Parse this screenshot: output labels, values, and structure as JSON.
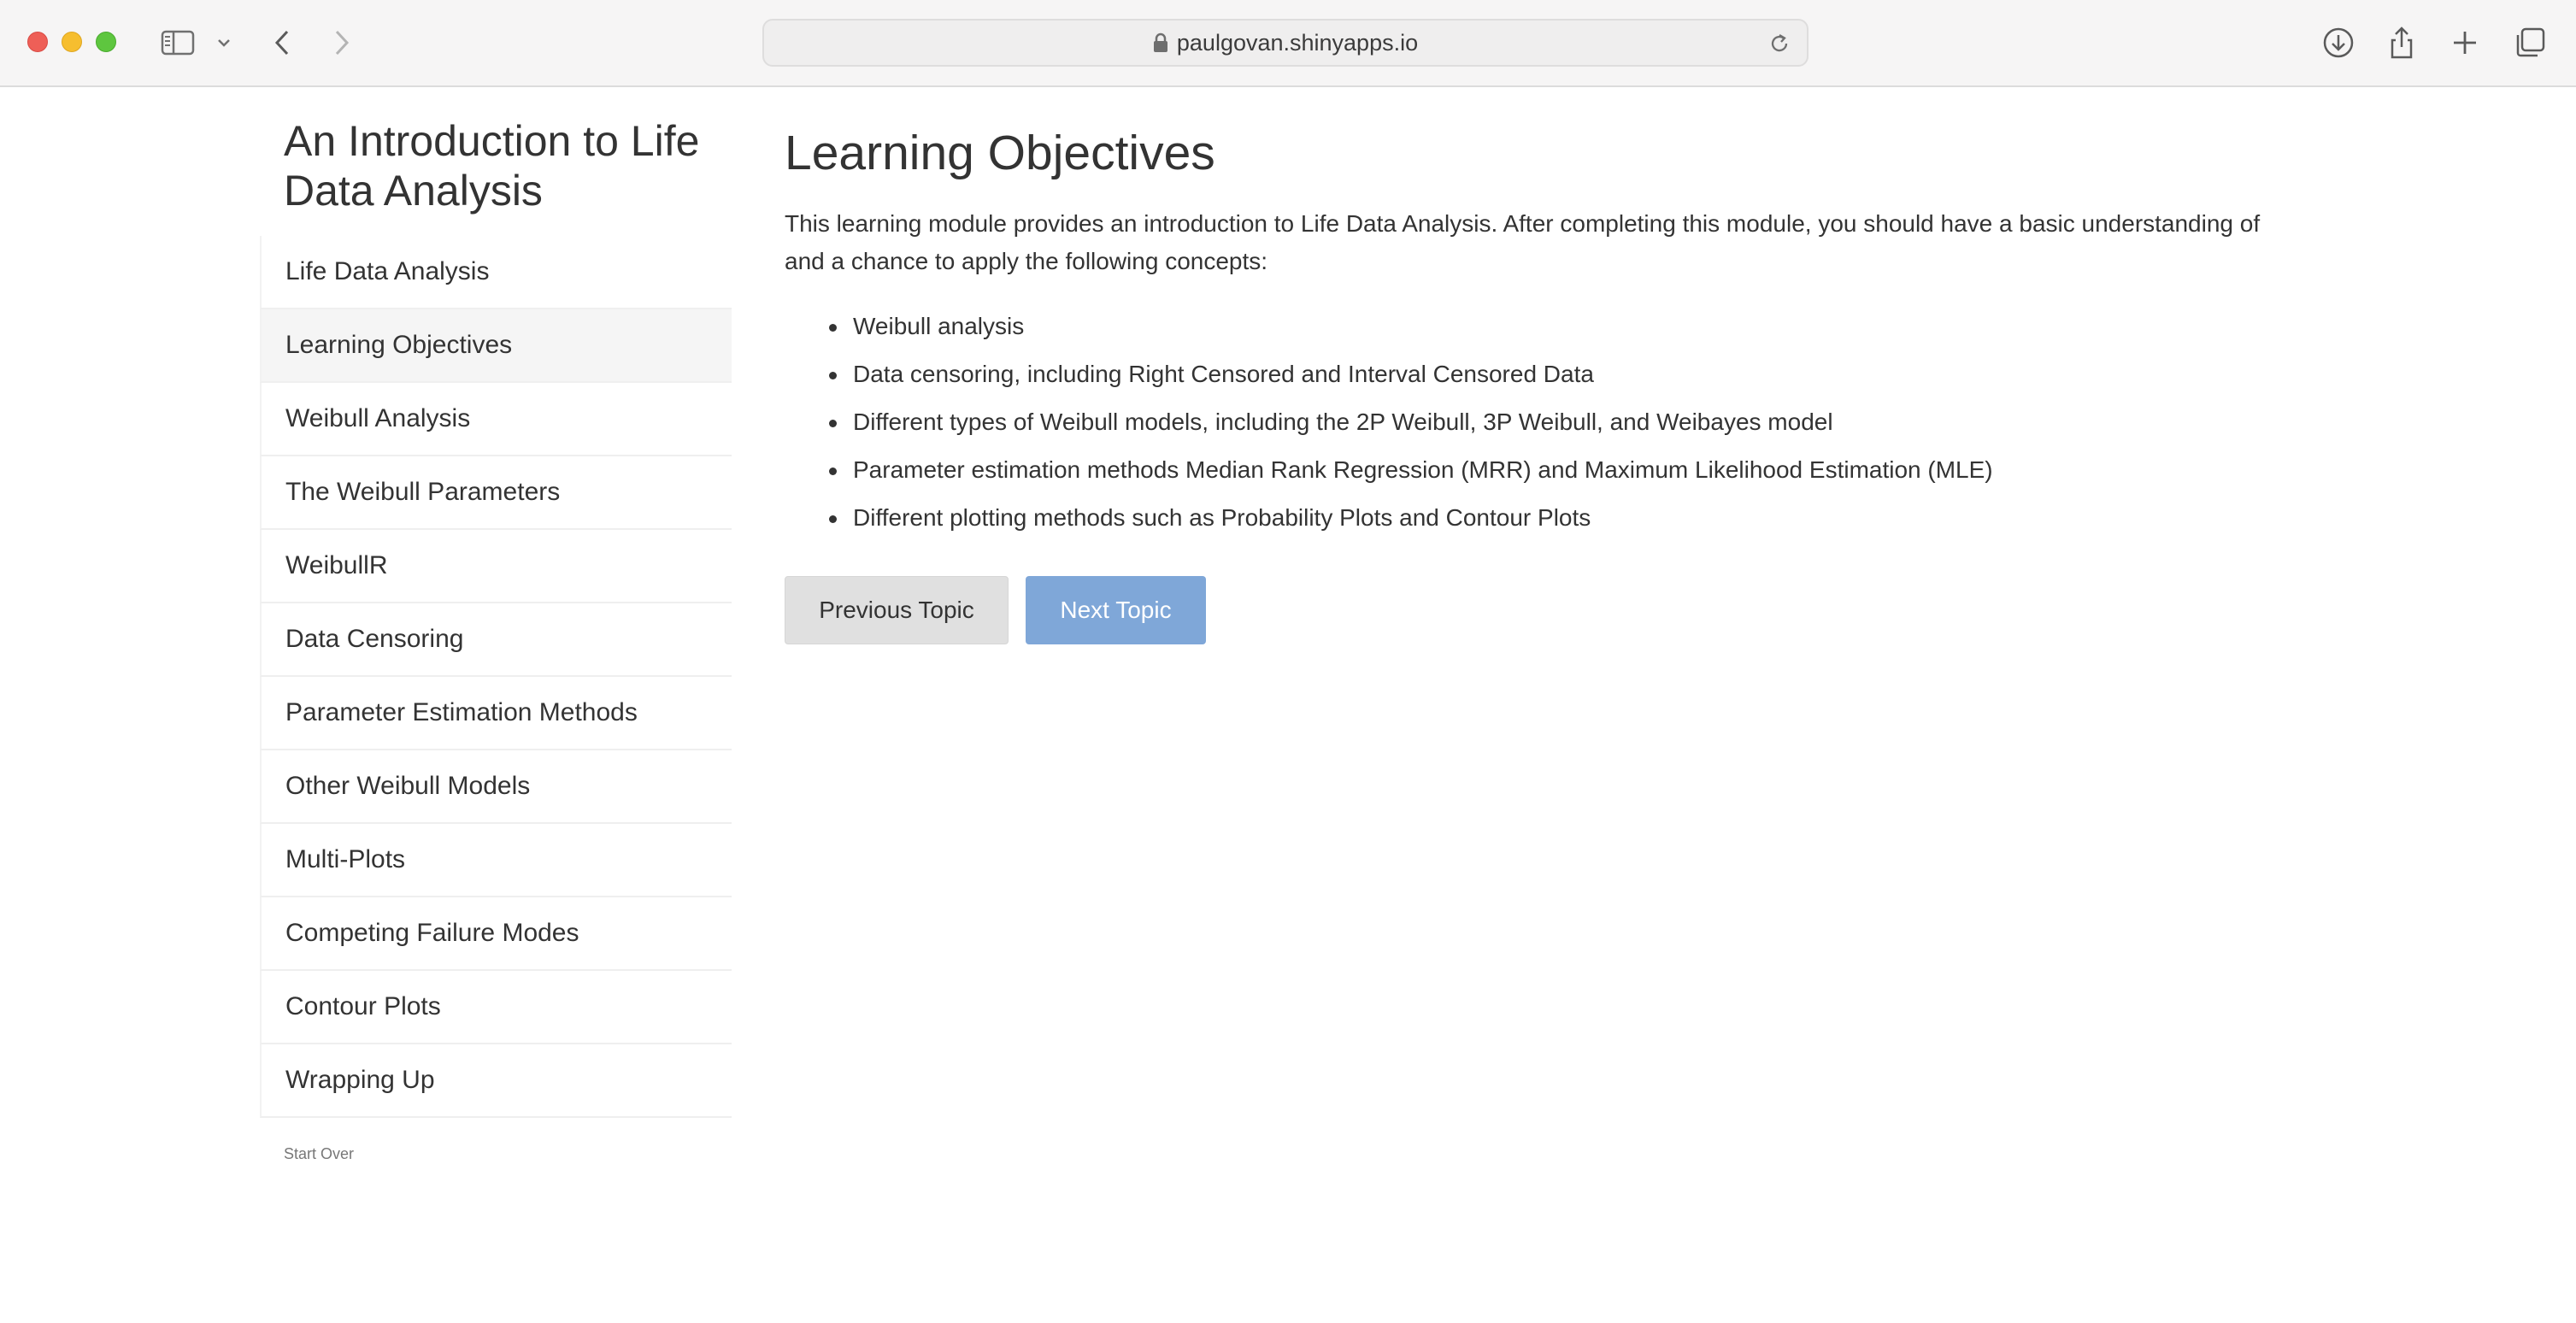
{
  "browser": {
    "url": "paulgovan.shinyapps.io"
  },
  "app": {
    "title": "An Introduction to Life Data Analysis",
    "nav_items": [
      {
        "label": "Life Data Analysis",
        "active": false
      },
      {
        "label": "Learning Objectives",
        "active": true
      },
      {
        "label": "Weibull Analysis",
        "active": false
      },
      {
        "label": "The Weibull Parameters",
        "active": false
      },
      {
        "label": "WeibullR",
        "active": false
      },
      {
        "label": "Data Censoring",
        "active": false
      },
      {
        "label": "Parameter Estimation Methods",
        "active": false
      },
      {
        "label": "Other Weibull Models",
        "active": false
      },
      {
        "label": "Multi-Plots",
        "active": false
      },
      {
        "label": "Competing Failure Modes",
        "active": false
      },
      {
        "label": "Contour Plots",
        "active": false
      },
      {
        "label": "Wrapping Up",
        "active": false
      }
    ],
    "start_over_label": "Start Over"
  },
  "main": {
    "title": "Learning Objectives",
    "intro": "This learning module provides an introduction to Life Data Analysis. After completing this module, you should have a basic understanding of and a chance to apply the following concepts:",
    "concepts": [
      "Weibull analysis",
      "Data censoring, including Right Censored and Interval Censored Data",
      "Different types of Weibull models, including the 2P Weibull, 3P Weibull, and Weibayes model",
      "Parameter estimation methods Median Rank Regression (MRR) and Maximum Likelihood Estimation (MLE)",
      "Different plotting methods such as Probability Plots and Contour Plots"
    ],
    "prev_button": "Previous Topic",
    "next_button": "Next Topic"
  },
  "colors": {
    "next_button": "#7fa7d8",
    "prev_button": "#e0e0e0",
    "active_nav": "#f5f5f5"
  }
}
